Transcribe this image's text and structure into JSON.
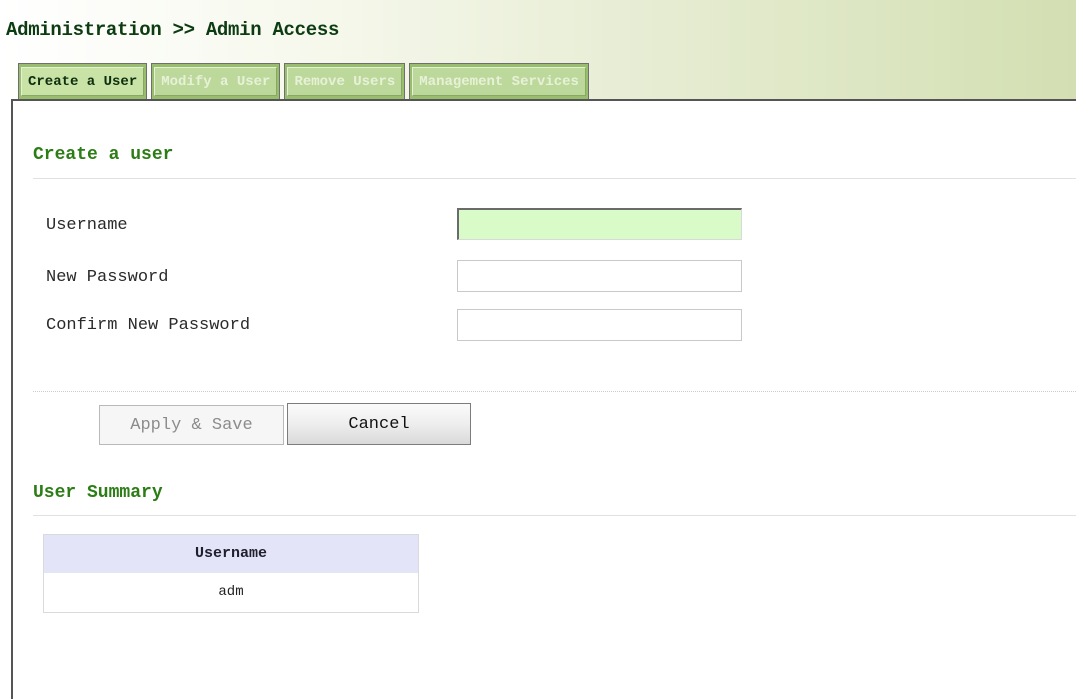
{
  "breadcrumb": "Administration >> Admin Access",
  "tabs": [
    {
      "label": "Create a User",
      "active": true
    },
    {
      "label": "Modify a User",
      "active": false
    },
    {
      "label": "Remove Users",
      "active": false
    },
    {
      "label": "Management Services",
      "active": false
    }
  ],
  "create_section": {
    "title": "Create a user",
    "fields": [
      {
        "label": "Username",
        "value": "",
        "focused": true
      },
      {
        "label": "New Password",
        "value": ""
      },
      {
        "label": "Confirm New Password",
        "value": ""
      }
    ]
  },
  "buttons": {
    "apply_label": "Apply & Save",
    "apply_enabled": false,
    "cancel_label": "Cancel"
  },
  "summary": {
    "title": "User Summary",
    "columns": [
      "Username"
    ],
    "rows": [
      [
        "adm"
      ]
    ]
  },
  "colors": {
    "section_title": "#2c7d16",
    "focused_input": "#d8fbc8",
    "tab_active": "#c9e2a5",
    "tab_inactive": "#bcd89b",
    "table_header": "#e4e4f8"
  }
}
